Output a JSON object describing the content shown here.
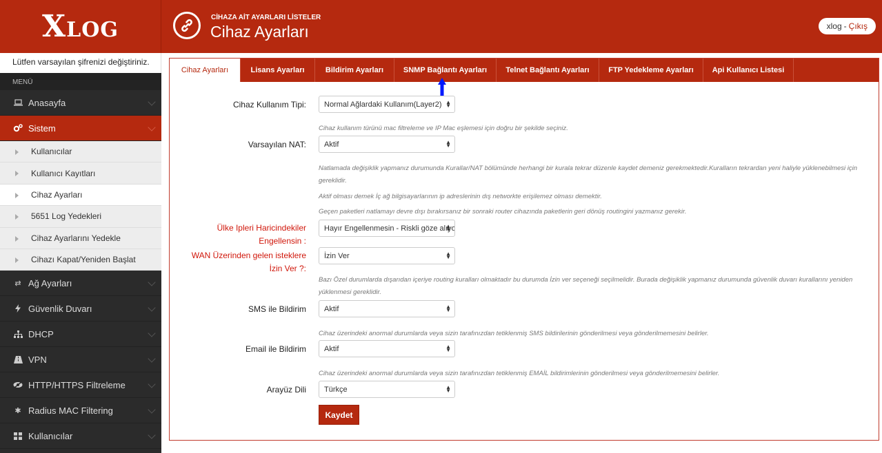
{
  "brand": {
    "logo_x": "X",
    "logo_rest": "LOG"
  },
  "header": {
    "subtitle": "CİHAZA AİT AYARLARI LİSTELER",
    "title": "Cihaz Ayarları",
    "user": "xlog",
    "separator": "-",
    "logout": "Çıkış"
  },
  "sidebar": {
    "notice": "Lütfen varsayılan şifrenizi değiştiriniz.",
    "menu_label": "MENÜ",
    "items": [
      {
        "label": "Anasayfa",
        "icon": "laptop-icon"
      },
      {
        "label": "Sistem",
        "icon": "gears-icon"
      },
      {
        "label": "Ağ Ayarları",
        "icon": "shuffle-icon"
      },
      {
        "label": "Güvenlik Duvarı",
        "icon": "bolt-icon"
      },
      {
        "label": "DHCP",
        "icon": "sitemap-icon"
      },
      {
        "label": "VPN",
        "icon": "road-icon"
      },
      {
        "label": "HTTP/HTTPS Filtreleme",
        "icon": "eye-slash-icon"
      },
      {
        "label": "Radius MAC Filtering",
        "icon": "asterisk-icon"
      },
      {
        "label": "Kullanıcılar",
        "icon": "grid-icon"
      }
    ],
    "sub_items": [
      "Kullanıcılar",
      "Kullanıcı Kayıtları",
      "Cihaz Ayarları",
      "5651 Log Yedekleri",
      "Cihaz Ayarlarını Yedekle",
      "Cihazı Kapat/Yeniden Başlat"
    ]
  },
  "tabs": [
    "Cihaz Ayarları",
    "Lisans Ayarları",
    "Bildirim Ayarları",
    "SNMP Bağlantı Ayarları",
    "Telnet Bağlantı Ayarları",
    "FTP Yedekleme Ayarları",
    "Api Kullanıcı Listesi"
  ],
  "form": {
    "usage_type": {
      "label": "Cihaz Kullanım Tipi:",
      "value": "Normal Ağlardaki Kullanım(Layer2)",
      "help": "Cihaz kullanım türünü mac filtreleme ve IP Mac eşlemesi için doğru bir şekilde seçiniz."
    },
    "nat": {
      "label": "Varsayılan NAT:",
      "value": "Aktif",
      "help1": "Natlamada değişiklik yapmanız durumunda Kurallar/NAT bölümünde herhangi bir kurala tekrar düzenle kaydet demeniz gerekmektedir.Kuralların tekrardan yeni haliyle yüklenebilmesi için gereklidir.",
      "help2": "Aktif olması demek İç ağ bilgisayarlarının ip adreslerinin dış networkte erişilemez olması demektir.",
      "help3": "Geçen paketleri natlamayı devre dışı bırakırsanız bir sonraki router cihazında paketlerin geri dönüş routingini yazmanız gerekir."
    },
    "country_block": {
      "label_line1": "Ülke Ipleri Haricindekiler",
      "label_line2": "Engellensin :",
      "value": "Hayır Engellenmesin - Riskli göze alıyorum"
    },
    "wan_requests": {
      "label_line1": "WAN Üzerinden gelen isteklere",
      "label_line2": "İzin Ver ?:",
      "value": "İzin Ver",
      "help": "Bazı Özel durumlarda dışarıdan içeriye routing kuralları olmaktadır bu durumda İzin ver seçeneği seçilmelidir. Burada değişiklik yapmanız durumunda güvenlik duvarı kurallarını yeniden yüklenmesi gereklidir."
    },
    "sms": {
      "label": "SMS ile Bildirim",
      "value": "Aktif",
      "help": "Cihaz üzerindeki anormal durumlarda veya sizin tarafınızdan tetiklenmiş SMS bildirilerinin gönderilmesi veya gönderilmemesini belirler."
    },
    "email": {
      "label": "Email ile Bildirim",
      "value": "Aktif",
      "help": "Cihaz üzerindeki anormal durumlarda veya sizin tarafınızdan tetiklenmiş EMAİL bildirimlerinin gönderilmesi veya gönderilmemesini belirler."
    },
    "language": {
      "label": "Arayüz Dili",
      "value": "Türkçe"
    },
    "save_label": "Kaydet"
  },
  "colors": {
    "brand_red": "#b5290f",
    "sidebar_dark": "#2b2b2b",
    "warning_red": "#d0160a",
    "arrow_blue": "#0019ff"
  }
}
